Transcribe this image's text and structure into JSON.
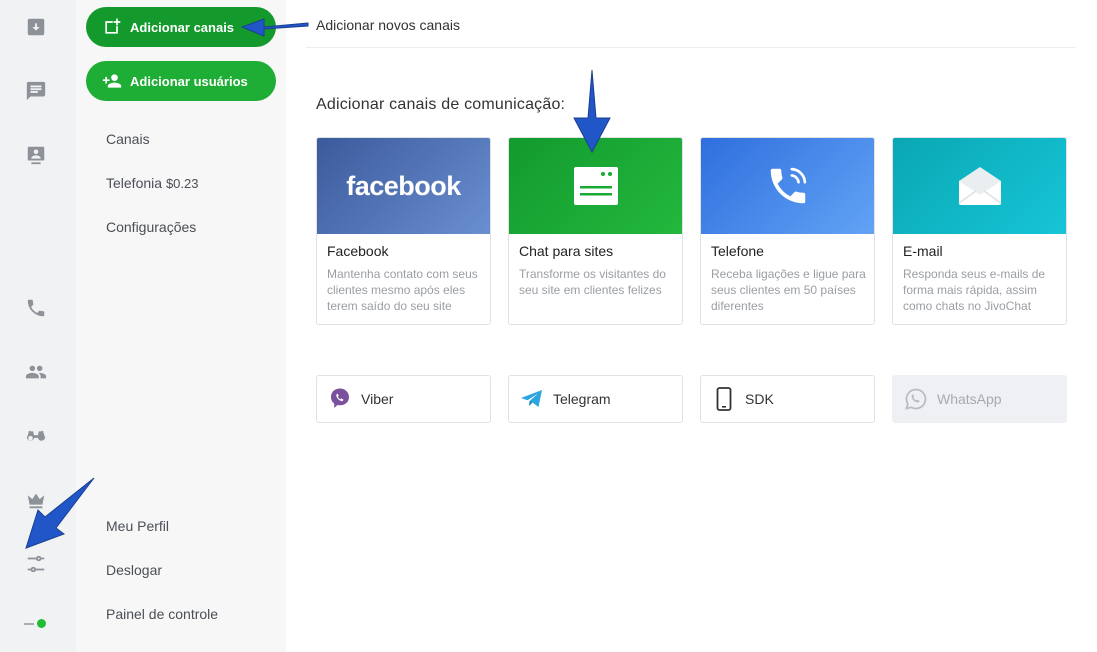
{
  "rail": {
    "icons": [
      "inbox-download-icon",
      "chat-icon",
      "monitor-user-icon",
      "phone-icon",
      "people-icon",
      "binoculars-icon",
      "crown-icon",
      "sliders-icon"
    ]
  },
  "menu": {
    "add_channels": "Adicionar canais",
    "add_users": "Adicionar usuários",
    "links": {
      "channels": "Canais",
      "telephony": "Telefonia",
      "telephony_price": "$0.23",
      "settings": "Configurações",
      "profile": "Meu Perfil",
      "logout": "Deslogar",
      "control_panel": "Painel de controle"
    }
  },
  "header": {
    "title": "Adicionar novos canais"
  },
  "main": {
    "section_title": "Adicionar canais de comunicação:",
    "cards": [
      {
        "name": "Facebook",
        "banner_text": "facebook",
        "desc": "Mantenha contato com seus clientes mesmo após eles terem saído do seu site",
        "color": "#4a6bb0"
      },
      {
        "name": "Chat para sites",
        "desc": "Transforme os visitantes do seu site em clientes felizes",
        "color": "#1aa935"
      },
      {
        "name": "Telefone",
        "desc": "Receba ligações e ligue para seus clientes em 50 países diferentes",
        "color": "#3d7fe6"
      },
      {
        "name": "E-mail",
        "desc": "Responda seus e-mails de forma mais rápida, assim como chats no JivoChat",
        "color": "#11b3c4"
      }
    ],
    "small_cards": [
      {
        "name": "Viber",
        "icon": "viber-icon",
        "color": "#7b519d"
      },
      {
        "name": "Telegram",
        "icon": "telegram-icon",
        "color": "#2ca5e0"
      },
      {
        "name": "SDK",
        "icon": "mobile-icon",
        "color": "#333333"
      },
      {
        "name": "WhatsApp",
        "icon": "whatsapp-icon",
        "color": "#b9bdc2"
      }
    ]
  },
  "status": {
    "online_color": "#1fbc34"
  }
}
